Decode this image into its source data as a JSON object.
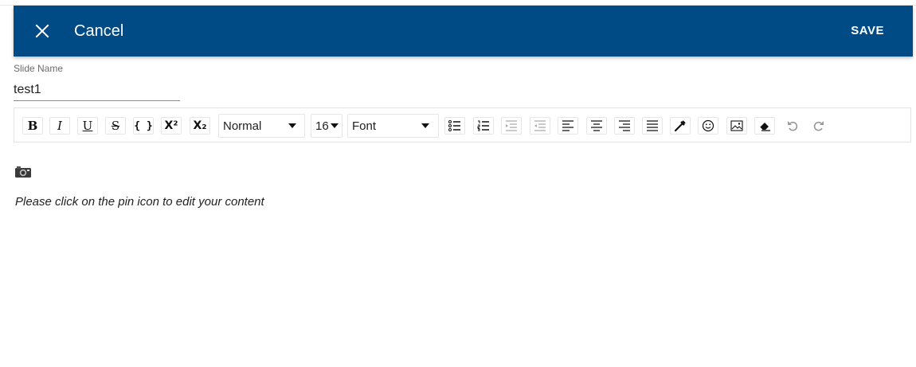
{
  "header": {
    "cancel_label": "Cancel",
    "save_label": "SAVE",
    "bg_color": "#004a85"
  },
  "slide_name": {
    "label": "Slide Name",
    "value": "test1"
  },
  "toolbar": {
    "bold": "B",
    "italic": "I",
    "underline": "U",
    "strike": "S",
    "code": "{ }",
    "superscript": "X²",
    "subscript": "X₂",
    "block_type": "Normal",
    "font_size": "16",
    "font_family": "Font",
    "icons": [
      "bullet-list-icon",
      "numbered-list-icon",
      "indent-icon",
      "outdent-icon",
      "align-left-icon",
      "align-center-icon",
      "align-right-icon",
      "justify-icon",
      "color-picker-icon",
      "emoji-icon",
      "image-icon",
      "eraser-icon",
      "undo-icon",
      "redo-icon"
    ]
  },
  "content": {
    "hint": "Please click on the pin icon to edit your content"
  }
}
